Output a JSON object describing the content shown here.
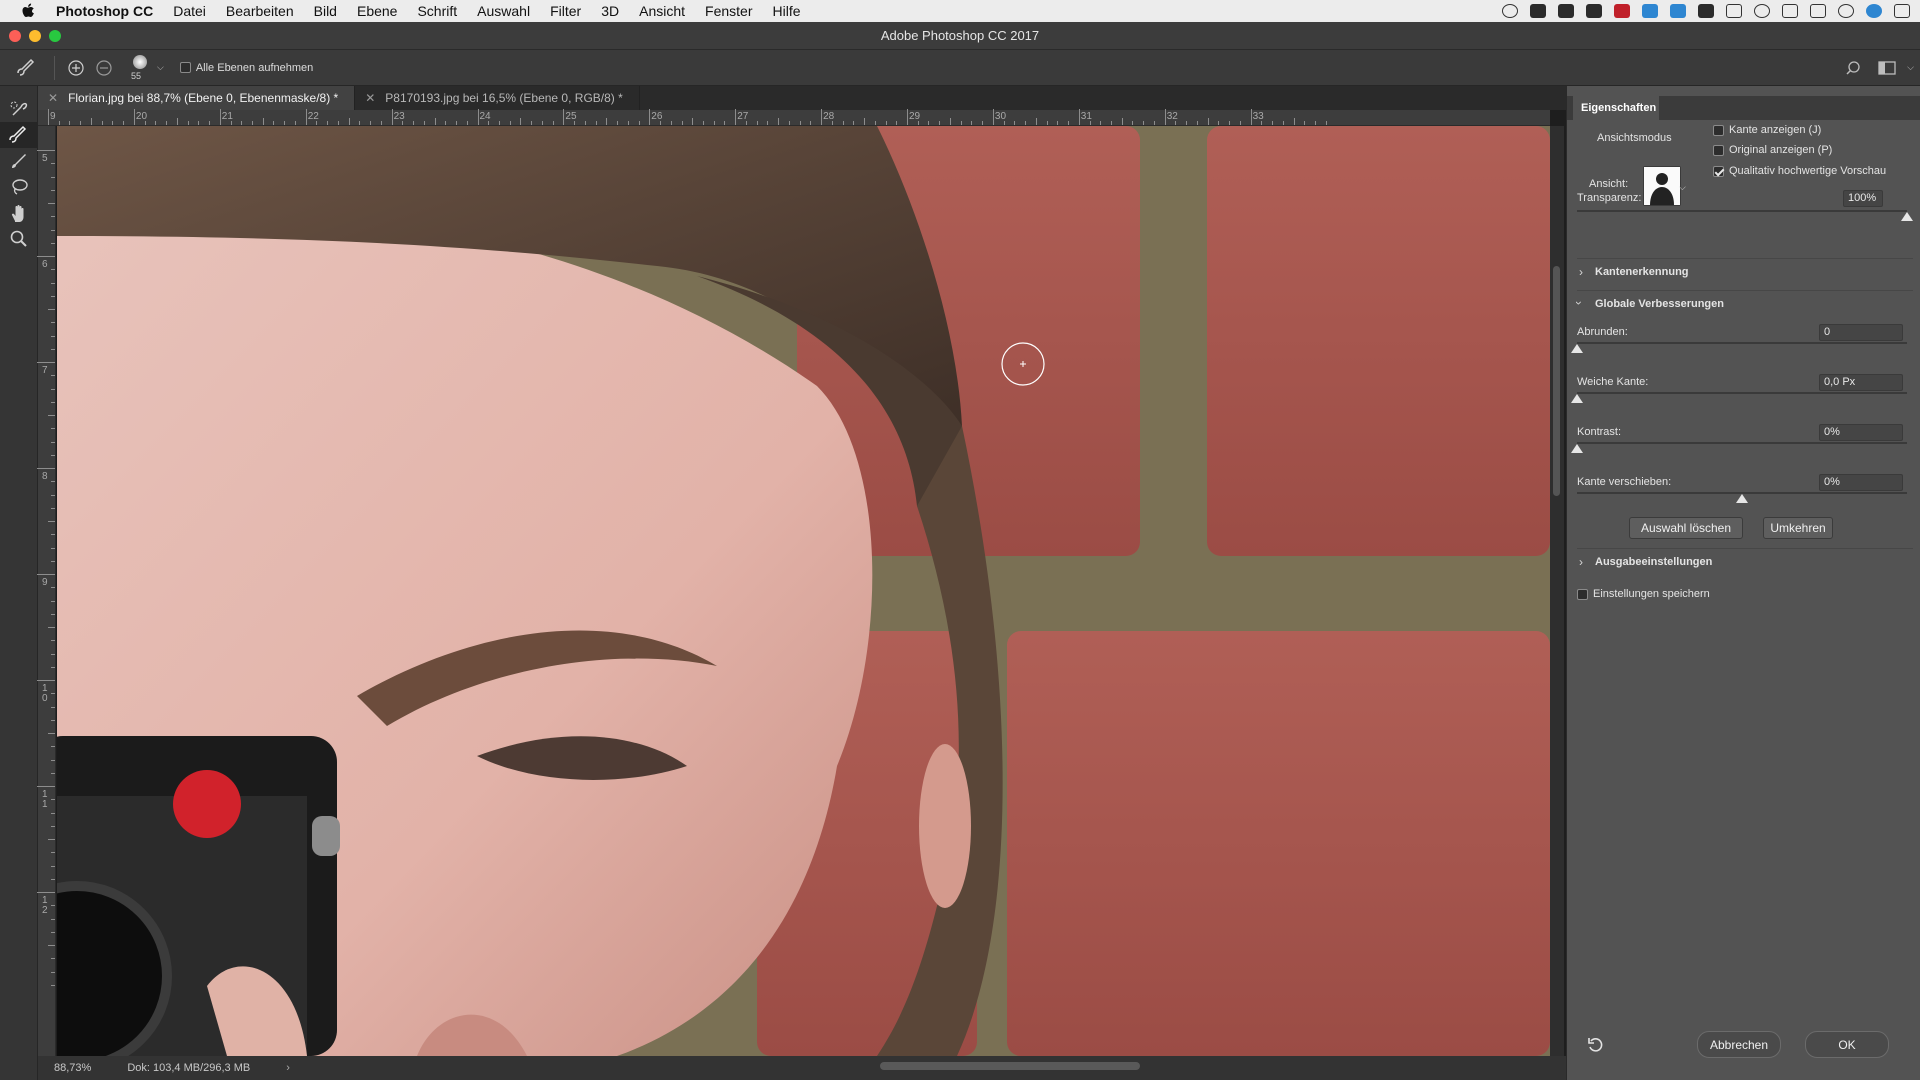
{
  "menubar": {
    "app_name": "Photoshop CC",
    "items": [
      "Datei",
      "Bearbeiten",
      "Bild",
      "Ebene",
      "Schrift",
      "Auswahl",
      "Filter",
      "3D",
      "Ansicht",
      "Fenster",
      "Hilfe"
    ]
  },
  "window": {
    "title": "Adobe Photoshop CC 2017"
  },
  "options_bar": {
    "brush_size": "55",
    "sample_all_layers_label": "Alle Ebenen aufnehmen",
    "sample_all_layers_checked": false
  },
  "tabs": [
    {
      "label": "Florian.jpg bei 88,7% (Ebene 0, Ebenenmaske/8) *",
      "active": true
    },
    {
      "label": "P8170193.jpg bei 16,5% (Ebene 0, RGB/8) *",
      "active": false
    }
  ],
  "rulers": {
    "horizontal": [
      "9",
      "20",
      "21",
      "22",
      "23",
      "24",
      "25",
      "26",
      "27",
      "28",
      "29",
      "30",
      "31",
      "32",
      "33"
    ],
    "vertical": [
      "5",
      "6",
      "7",
      "8",
      "9",
      "1\n0",
      "1\n1",
      "1\n2"
    ]
  },
  "status": {
    "zoom": "88,73%",
    "doc": "Dok: 103,4 MB/296,3 MB"
  },
  "properties": {
    "tab_label": "Eigenschaften",
    "view_mode": {
      "section_label": "Ansichtsmodus",
      "view_label": "Ansicht:",
      "show_edge": {
        "label": "Kante anzeigen (J)",
        "checked": false
      },
      "show_original": {
        "label": "Original anzeigen (P)",
        "checked": false
      },
      "hq_preview": {
        "label": "Qualitativ hochwertige Vorschau",
        "checked": true
      }
    },
    "transparency": {
      "label": "Transparenz:",
      "value": "100%",
      "level": 1.0
    },
    "edge_detection": {
      "label": "Kantenerkennung"
    },
    "global": {
      "label": "Globale Verbesserungen",
      "smooth": {
        "label": "Abrunden:",
        "value": "0",
        "level": 0.0
      },
      "feather": {
        "label": "Weiche Kante:",
        "value": "0,0 Px",
        "level": 0.0
      },
      "contrast": {
        "label": "Kontrast:",
        "value": "0%",
        "level": 0.0
      },
      "shift_edge": {
        "label": "Kante verschieben:",
        "value": "0%",
        "level": 0.5
      },
      "clear_selection_label": "Auswahl löschen",
      "invert_label": "Umkehren"
    },
    "output": {
      "label": "Ausgabeeinstellungen"
    },
    "remember": {
      "label": "Einstellungen speichern",
      "checked": false
    },
    "cancel_label": "Abbrechen",
    "ok_label": "OK"
  }
}
